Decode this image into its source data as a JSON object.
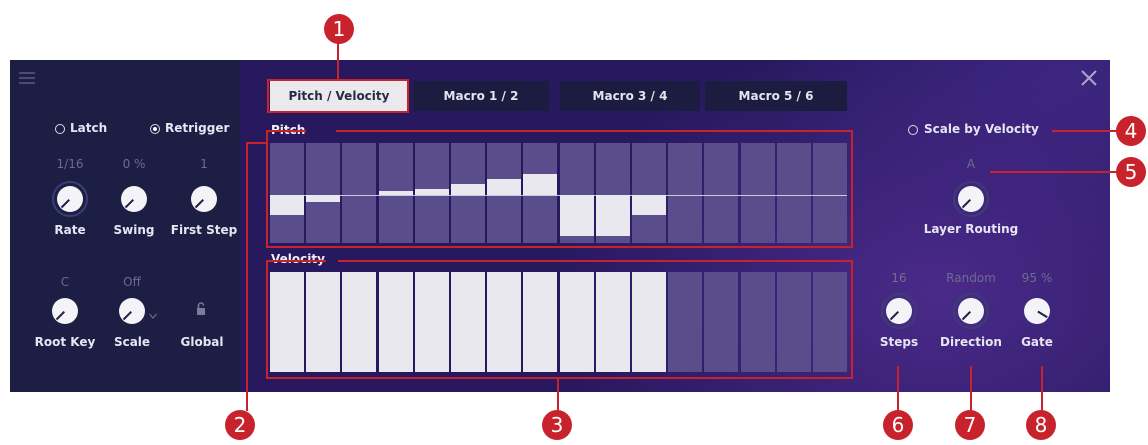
{
  "tabs": [
    {
      "label": "Pitch / Velocity",
      "active": true
    },
    {
      "label": "Macro 1 / 2",
      "active": false
    },
    {
      "label": "Macro 3 / 4",
      "active": false
    },
    {
      "label": "Macro 5 / 6",
      "active": false
    }
  ],
  "sidebar": {
    "latch_label": "Latch",
    "latch_checked": false,
    "retrigger_label": "Retrigger",
    "retrigger_checked": true,
    "rate": {
      "value": "1/16",
      "label": "Rate"
    },
    "swing": {
      "value": "0 %",
      "label": "Swing"
    },
    "first_step": {
      "value": "1",
      "label": "First Step"
    },
    "root_key": {
      "value": "C",
      "label": "Root Key"
    },
    "scale": {
      "value": "Off",
      "label": "Scale"
    },
    "global": {
      "label": "Global",
      "icon": "lock-icon"
    }
  },
  "pitch": {
    "label": "Pitch",
    "steps": [
      -0.38,
      -0.14,
      0,
      0.08,
      0.12,
      0.22,
      0.3,
      0.4,
      -0.78,
      -0.78,
      -0.38,
      0,
      0,
      0,
      0,
      0
    ]
  },
  "velocity": {
    "label": "Velocity",
    "active_steps": 11,
    "total_steps": 16
  },
  "right": {
    "scale_by_velocity_label": "Scale by Velocity",
    "scale_by_velocity_checked": false,
    "layer_routing": {
      "value": "A",
      "label": "Layer Routing"
    },
    "steps": {
      "value": "16",
      "label": "Steps"
    },
    "direction": {
      "value": "Random",
      "label": "Direction"
    },
    "gate": {
      "value": "95 %",
      "label": "Gate",
      "level": 0.95
    }
  },
  "callouts": [
    "1",
    "2",
    "3",
    "4",
    "5",
    "6",
    "7",
    "8"
  ],
  "icons": {
    "menu": "menu-icon",
    "close": "close-icon"
  },
  "colors": {
    "callout": "#c8232c",
    "panel": "#28195f",
    "sidebar": "#1c1e44"
  }
}
